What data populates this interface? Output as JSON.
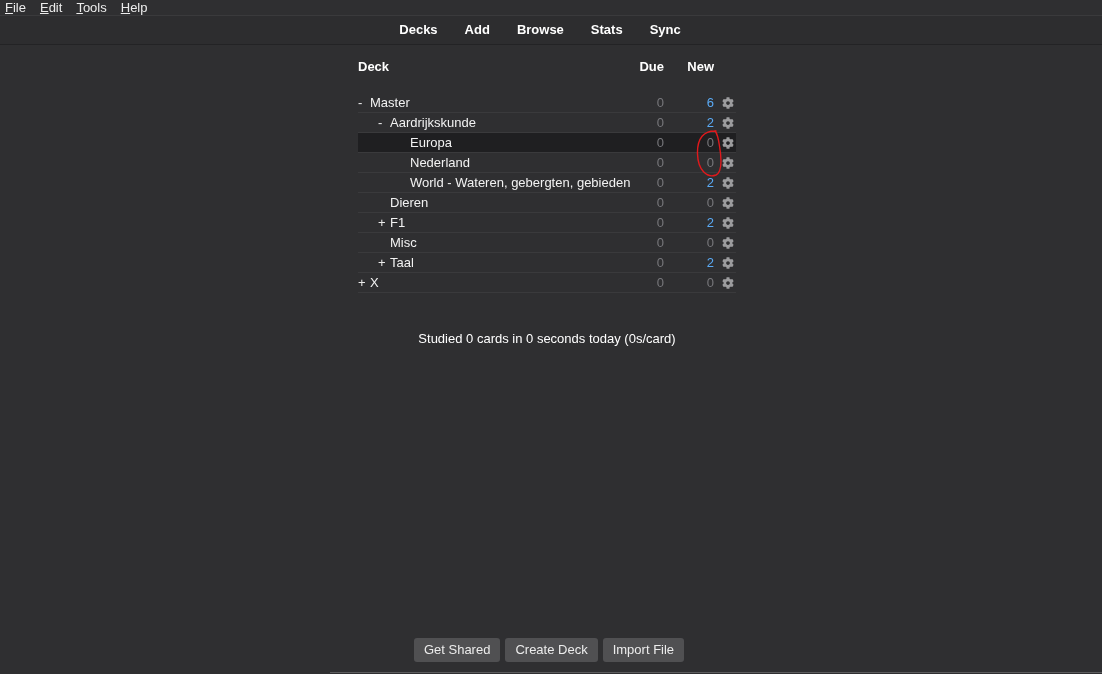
{
  "menu": [
    {
      "label": "File"
    },
    {
      "label": "Edit"
    },
    {
      "label": "Tools"
    },
    {
      "label": "Help"
    }
  ],
  "toolbar": [
    {
      "label": "Decks"
    },
    {
      "label": "Add"
    },
    {
      "label": "Browse"
    },
    {
      "label": "Stats"
    },
    {
      "label": "Sync"
    }
  ],
  "table": {
    "columns": [
      "Deck",
      "Due",
      "New"
    ],
    "rows": [
      {
        "name": "Master",
        "toggle": "-",
        "selected": false,
        "due": {
          "value": "0",
          "zero": true
        },
        "new": {
          "value": "6",
          "zero": false
        },
        "children": [
          {
            "name": "Aardrijkskunde",
            "toggle": "-",
            "selected": false,
            "due": {
              "value": "0",
              "zero": true
            },
            "new": {
              "value": "2",
              "zero": false
            },
            "children": [
              {
                "name": "Europa",
                "selected": true,
                "due": {
                  "value": "0",
                  "zero": true
                },
                "new": {
                  "value": "0",
                  "zero": true
                }
              },
              {
                "name": "Nederland",
                "selected": false,
                "due": {
                  "value": "0",
                  "zero": true
                },
                "new": {
                  "value": "0",
                  "zero": true
                }
              },
              {
                "name": "World - Wateren, gebergten, gebieden",
                "selected": false,
                "due": {
                  "value": "0",
                  "zero": true
                },
                "new": {
                  "value": "2",
                  "zero": false
                }
              }
            ]
          },
          {
            "name": "Dieren",
            "selected": false,
            "due": {
              "value": "0",
              "zero": true
            },
            "new": {
              "value": "0",
              "zero": true
            }
          },
          {
            "name": "F1",
            "toggle": "+",
            "selected": false,
            "due": {
              "value": "0",
              "zero": true
            },
            "new": {
              "value": "2",
              "zero": false
            }
          },
          {
            "name": "Misc",
            "selected": false,
            "due": {
              "value": "0",
              "zero": true
            },
            "new": {
              "value": "0",
              "zero": true
            }
          },
          {
            "name": "Taal",
            "toggle": "+",
            "selected": false,
            "due": {
              "value": "0",
              "zero": true
            },
            "new": {
              "value": "2",
              "zero": false
            }
          }
        ]
      },
      {
        "name": "X",
        "toggle": "+",
        "selected": false,
        "due": {
          "value": "0",
          "zero": true
        },
        "new": {
          "value": "0",
          "zero": true
        }
      }
    ]
  },
  "stats": "Studied 0 cards in 0 seconds today (0s/card)",
  "buttons": [
    "Get Shared",
    "Create Deck",
    "Import File"
  ]
}
